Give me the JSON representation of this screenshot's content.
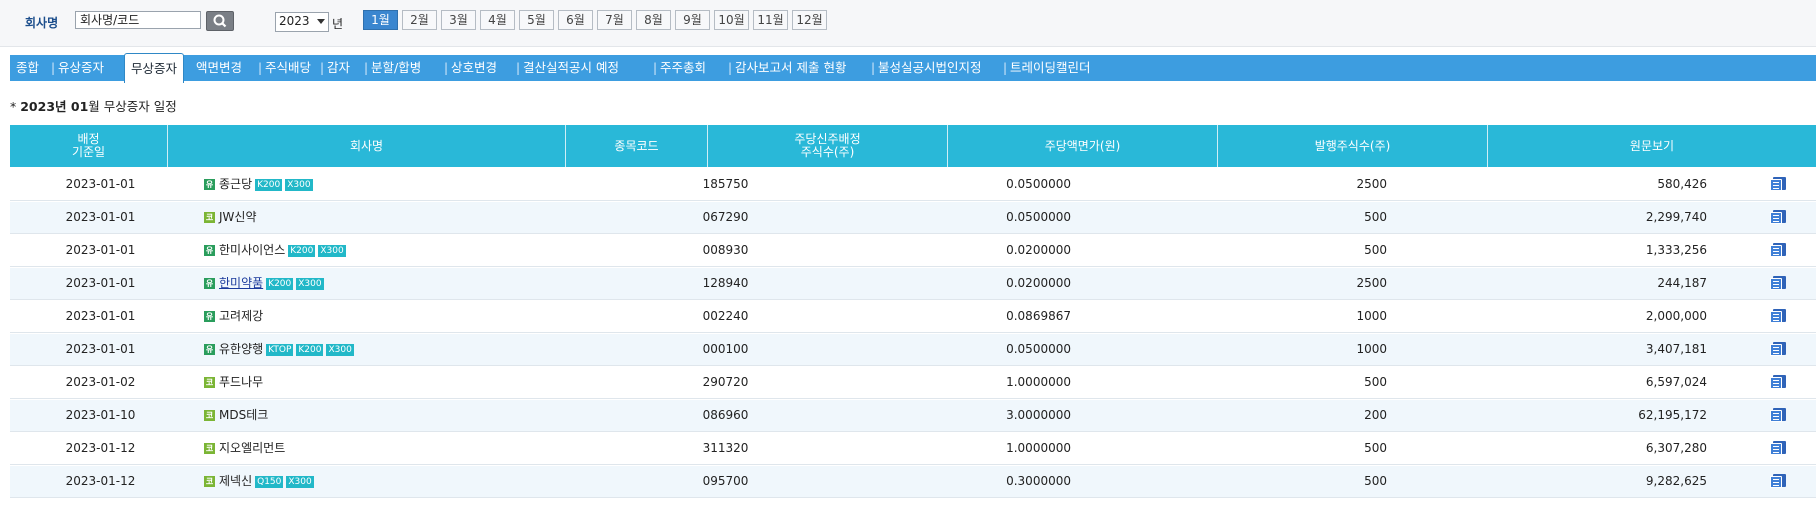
{
  "filter": {
    "company_label": "회사명",
    "search_value": "회사명/코드",
    "year_value": "2023",
    "year_suffix": "년",
    "months": [
      "1월",
      "2월",
      "3월",
      "4월",
      "5월",
      "6월",
      "7월",
      "8월",
      "9월",
      "10월",
      "11월",
      "12월"
    ],
    "active_month_index": 0
  },
  "tabs": [
    {
      "label": "종합"
    },
    {
      "label": "유상증자"
    },
    {
      "label": "무상증자",
      "active": true
    },
    {
      "label": "액면변경"
    },
    {
      "label": "주식배당"
    },
    {
      "label": "감자"
    },
    {
      "label": "분할/합병"
    },
    {
      "label": "상호변경"
    },
    {
      "label": "결산실적공시 예정"
    },
    {
      "label": "주주총회"
    },
    {
      "label": "감사보고서 제출 현황"
    },
    {
      "label": "불성실공시법인지정"
    },
    {
      "label": "트레이딩캘린더"
    }
  ],
  "section": {
    "prefix": "* ",
    "year_bold": "2023년 01",
    "suffix": "월 무상증자 일정"
  },
  "table": {
    "headers": {
      "date_line1": "배정",
      "date_line2": "기준일",
      "company": "회사명",
      "code": "종목코드",
      "ratio_line1": "주당신주배정",
      "ratio_line2": "주식수(주)",
      "par": "주당액면가(원)",
      "shares": "발행주식수(주)",
      "doc": "원문보기"
    },
    "rows": [
      {
        "date": "2023-01-01",
        "market": "유",
        "name": "종근당",
        "badges": [
          "K200",
          "X300"
        ],
        "code": "185750",
        "ratio": "0.0500000",
        "par": "2500",
        "shares": "580,426"
      },
      {
        "date": "2023-01-01",
        "market": "코",
        "name": "JW신약",
        "badges": [],
        "code": "067290",
        "ratio": "0.0500000",
        "par": "500",
        "shares": "2,299,740"
      },
      {
        "date": "2023-01-01",
        "market": "유",
        "name": "한미사이언스",
        "badges": [
          "K200",
          "X300"
        ],
        "code": "008930",
        "ratio": "0.0200000",
        "par": "500",
        "shares": "1,333,256"
      },
      {
        "date": "2023-01-01",
        "market": "유",
        "name": "한미약품",
        "badges": [
          "K200",
          "X300"
        ],
        "code": "128940",
        "ratio": "0.0200000",
        "par": "2500",
        "shares": "244,187",
        "link": true
      },
      {
        "date": "2023-01-01",
        "market": "유",
        "name": "고려제강",
        "badges": [],
        "code": "002240",
        "ratio": "0.0869867",
        "par": "1000",
        "shares": "2,000,000"
      },
      {
        "date": "2023-01-01",
        "market": "유",
        "name": "유한양행",
        "badges": [
          "KTOP",
          "K200",
          "X300"
        ],
        "code": "000100",
        "ratio": "0.0500000",
        "par": "1000",
        "shares": "3,407,181"
      },
      {
        "date": "2023-01-02",
        "market": "코",
        "name": "푸드나무",
        "badges": [],
        "code": "290720",
        "ratio": "1.0000000",
        "par": "500",
        "shares": "6,597,024"
      },
      {
        "date": "2023-01-10",
        "market": "코",
        "name": "MDS테크",
        "badges": [],
        "code": "086960",
        "ratio": "3.0000000",
        "par": "200",
        "shares": "62,195,172"
      },
      {
        "date": "2023-01-12",
        "market": "코",
        "name": "지오엘리먼트",
        "badges": [],
        "code": "311320",
        "ratio": "1.0000000",
        "par": "500",
        "shares": "6,307,280"
      },
      {
        "date": "2023-01-12",
        "market": "코",
        "name": "제넥신",
        "badges": [
          "Q150",
          "X300"
        ],
        "code": "095700",
        "ratio": "0.3000000",
        "par": "500",
        "shares": "9,282,625"
      }
    ]
  },
  "colors": {
    "accent_tab": "#3d9de0",
    "table_header": "#29b8d8",
    "active_month": "#3a86cf"
  }
}
